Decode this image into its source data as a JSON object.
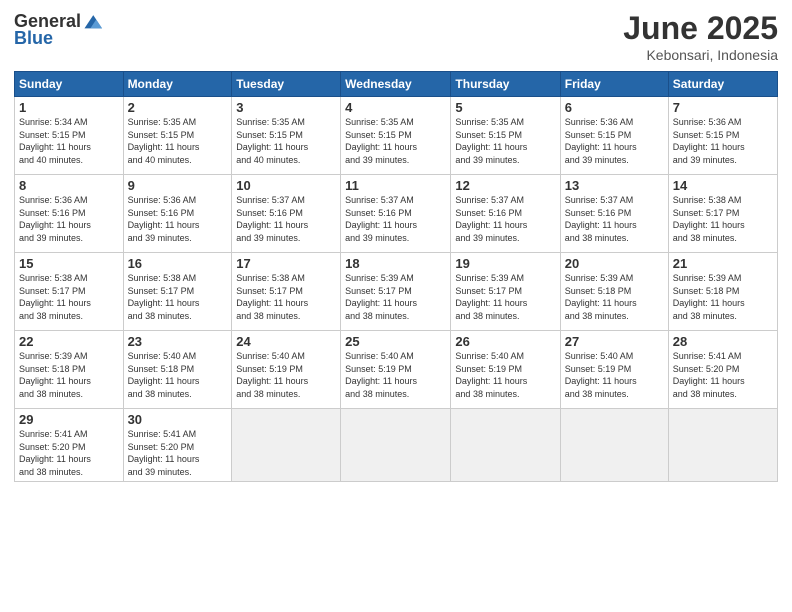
{
  "header": {
    "title": "June 2025",
    "location": "Kebonsari, Indonesia"
  },
  "columns": [
    "Sunday",
    "Monday",
    "Tuesday",
    "Wednesday",
    "Thursday",
    "Friday",
    "Saturday"
  ],
  "weeks": [
    [
      {
        "day": "1",
        "info": "Sunrise: 5:34 AM\nSunset: 5:15 PM\nDaylight: 11 hours\nand 40 minutes."
      },
      {
        "day": "2",
        "info": "Sunrise: 5:35 AM\nSunset: 5:15 PM\nDaylight: 11 hours\nand 40 minutes."
      },
      {
        "day": "3",
        "info": "Sunrise: 5:35 AM\nSunset: 5:15 PM\nDaylight: 11 hours\nand 40 minutes."
      },
      {
        "day": "4",
        "info": "Sunrise: 5:35 AM\nSunset: 5:15 PM\nDaylight: 11 hours\nand 39 minutes."
      },
      {
        "day": "5",
        "info": "Sunrise: 5:35 AM\nSunset: 5:15 PM\nDaylight: 11 hours\nand 39 minutes."
      },
      {
        "day": "6",
        "info": "Sunrise: 5:36 AM\nSunset: 5:15 PM\nDaylight: 11 hours\nand 39 minutes."
      },
      {
        "day": "7",
        "info": "Sunrise: 5:36 AM\nSunset: 5:15 PM\nDaylight: 11 hours\nand 39 minutes."
      }
    ],
    [
      {
        "day": "8",
        "info": "Sunrise: 5:36 AM\nSunset: 5:16 PM\nDaylight: 11 hours\nand 39 minutes."
      },
      {
        "day": "9",
        "info": "Sunrise: 5:36 AM\nSunset: 5:16 PM\nDaylight: 11 hours\nand 39 minutes."
      },
      {
        "day": "10",
        "info": "Sunrise: 5:37 AM\nSunset: 5:16 PM\nDaylight: 11 hours\nand 39 minutes."
      },
      {
        "day": "11",
        "info": "Sunrise: 5:37 AM\nSunset: 5:16 PM\nDaylight: 11 hours\nand 39 minutes."
      },
      {
        "day": "12",
        "info": "Sunrise: 5:37 AM\nSunset: 5:16 PM\nDaylight: 11 hours\nand 39 minutes."
      },
      {
        "day": "13",
        "info": "Sunrise: 5:37 AM\nSunset: 5:16 PM\nDaylight: 11 hours\nand 38 minutes."
      },
      {
        "day": "14",
        "info": "Sunrise: 5:38 AM\nSunset: 5:17 PM\nDaylight: 11 hours\nand 38 minutes."
      }
    ],
    [
      {
        "day": "15",
        "info": "Sunrise: 5:38 AM\nSunset: 5:17 PM\nDaylight: 11 hours\nand 38 minutes."
      },
      {
        "day": "16",
        "info": "Sunrise: 5:38 AM\nSunset: 5:17 PM\nDaylight: 11 hours\nand 38 minutes."
      },
      {
        "day": "17",
        "info": "Sunrise: 5:38 AM\nSunset: 5:17 PM\nDaylight: 11 hours\nand 38 minutes."
      },
      {
        "day": "18",
        "info": "Sunrise: 5:39 AM\nSunset: 5:17 PM\nDaylight: 11 hours\nand 38 minutes."
      },
      {
        "day": "19",
        "info": "Sunrise: 5:39 AM\nSunset: 5:17 PM\nDaylight: 11 hours\nand 38 minutes."
      },
      {
        "day": "20",
        "info": "Sunrise: 5:39 AM\nSunset: 5:18 PM\nDaylight: 11 hours\nand 38 minutes."
      },
      {
        "day": "21",
        "info": "Sunrise: 5:39 AM\nSunset: 5:18 PM\nDaylight: 11 hours\nand 38 minutes."
      }
    ],
    [
      {
        "day": "22",
        "info": "Sunrise: 5:39 AM\nSunset: 5:18 PM\nDaylight: 11 hours\nand 38 minutes."
      },
      {
        "day": "23",
        "info": "Sunrise: 5:40 AM\nSunset: 5:18 PM\nDaylight: 11 hours\nand 38 minutes."
      },
      {
        "day": "24",
        "info": "Sunrise: 5:40 AM\nSunset: 5:19 PM\nDaylight: 11 hours\nand 38 minutes."
      },
      {
        "day": "25",
        "info": "Sunrise: 5:40 AM\nSunset: 5:19 PM\nDaylight: 11 hours\nand 38 minutes."
      },
      {
        "day": "26",
        "info": "Sunrise: 5:40 AM\nSunset: 5:19 PM\nDaylight: 11 hours\nand 38 minutes."
      },
      {
        "day": "27",
        "info": "Sunrise: 5:40 AM\nSunset: 5:19 PM\nDaylight: 11 hours\nand 38 minutes."
      },
      {
        "day": "28",
        "info": "Sunrise: 5:41 AM\nSunset: 5:20 PM\nDaylight: 11 hours\nand 38 minutes."
      }
    ],
    [
      {
        "day": "29",
        "info": "Sunrise: 5:41 AM\nSunset: 5:20 PM\nDaylight: 11 hours\nand 38 minutes."
      },
      {
        "day": "30",
        "info": "Sunrise: 5:41 AM\nSunset: 5:20 PM\nDaylight: 11 hours\nand 39 minutes."
      },
      {
        "day": "",
        "info": ""
      },
      {
        "day": "",
        "info": ""
      },
      {
        "day": "",
        "info": ""
      },
      {
        "day": "",
        "info": ""
      },
      {
        "day": "",
        "info": ""
      }
    ]
  ]
}
